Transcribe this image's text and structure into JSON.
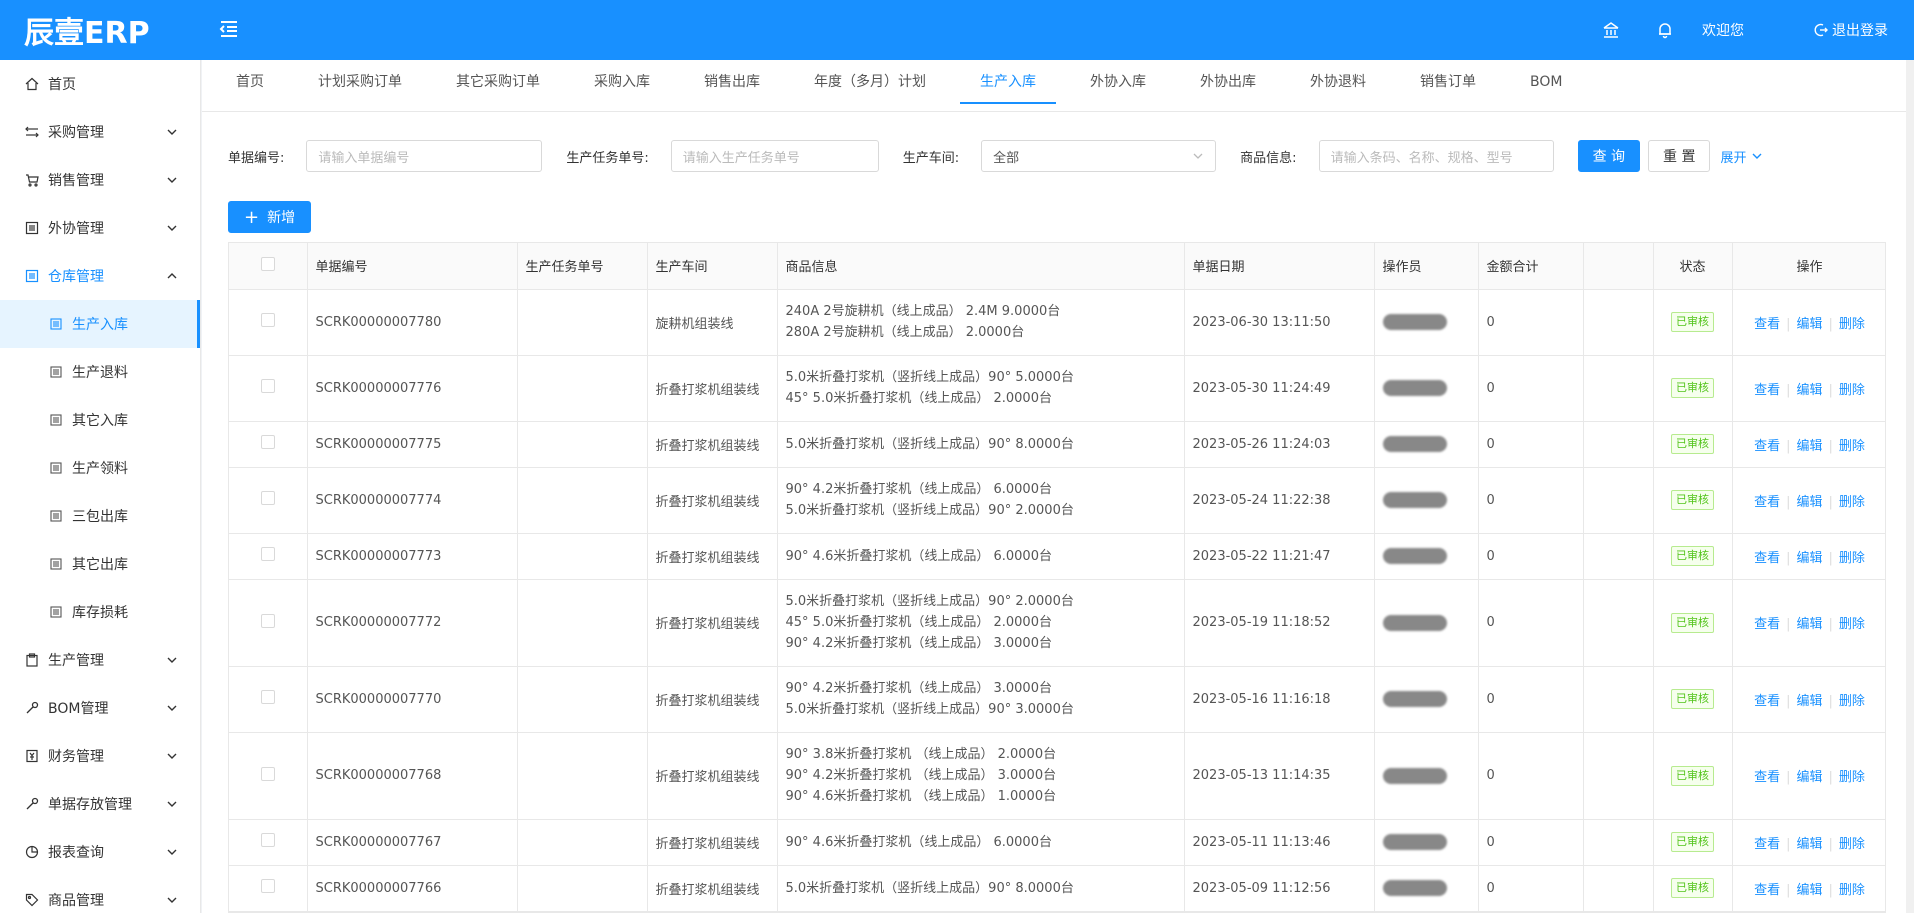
{
  "header": {
    "logo": "辰壹ERP",
    "welcome": "欢迎您",
    "logout": "退出登录"
  },
  "sidebar": {
    "items": [
      {
        "label": "首页",
        "icon": "home-icon"
      },
      {
        "label": "采购管理",
        "icon": "swap-icon"
      },
      {
        "label": "销售管理",
        "icon": "cart-icon"
      },
      {
        "label": "外协管理",
        "icon": "list-icon"
      },
      {
        "label": "仓库管理",
        "icon": "warehouse-icon"
      }
    ],
    "warehouse_sub": [
      {
        "label": "生产入库"
      },
      {
        "label": "生产退料"
      },
      {
        "label": "其它入库"
      },
      {
        "label": "生产领料"
      },
      {
        "label": "三包出库"
      },
      {
        "label": "其它出库"
      },
      {
        "label": "库存损耗"
      }
    ],
    "items_after": [
      {
        "label": "生产管理",
        "icon": "clipboard-icon"
      },
      {
        "label": "BOM管理",
        "icon": "wrench-icon"
      },
      {
        "label": "财务管理",
        "icon": "money-icon"
      },
      {
        "label": "单据存放管理",
        "icon": "tool-icon"
      },
      {
        "label": "报表查询",
        "icon": "pie-chart-icon"
      },
      {
        "label": "商品管理",
        "icon": "tag-icon"
      }
    ]
  },
  "tabs": [
    {
      "label": "首页"
    },
    {
      "label": "计划采购订单"
    },
    {
      "label": "其它采购订单"
    },
    {
      "label": "采购入库"
    },
    {
      "label": "销售出库"
    },
    {
      "label": "年度（多月）计划"
    },
    {
      "label": "生产入库"
    },
    {
      "label": "外协入库"
    },
    {
      "label": "外协出库"
    },
    {
      "label": "外协退料"
    },
    {
      "label": "销售订单"
    },
    {
      "label": "BOM"
    }
  ],
  "search": {
    "doc_no_label": "单据编号:",
    "doc_no_placeholder": "请输入单据编号",
    "task_no_label": "生产任务单号:",
    "task_no_placeholder": "请输入生产任务单号",
    "workshop_label": "生产车间:",
    "workshop_value": "全部",
    "goods_label": "商品信息:",
    "goods_placeholder": "请输入条码、名称、规格、型号",
    "query_btn": "查 询",
    "reset_btn": "重 置",
    "expand": "展开"
  },
  "add_btn": "新增",
  "table": {
    "headers": [
      "单据编号",
      "生产任务单号",
      "生产车间",
      "商品信息",
      "单据日期",
      "操作员",
      "金额合计",
      "",
      "状态",
      "操作"
    ],
    "ops": [
      "查看",
      "编辑",
      "删除"
    ],
    "rows": [
      {
        "doc": "SCRK00000007780",
        "task": "",
        "shop": "旋耕机组装线",
        "goods": [
          "240A 2号旋耕机（线上成品） 2.4M 9.0000台",
          "280A 2号旋耕机（线上成品） 2.0000台"
        ],
        "date": "2023-06-30 13:11:50",
        "amount": "0",
        "status": "已审核"
      },
      {
        "doc": "SCRK00000007776",
        "task": "",
        "shop": "折叠打浆机组装线",
        "goods": [
          "5.0米折叠打浆机（竖折线上成品）90° 5.0000台",
          "45° 5.0米折叠打浆机（线上成品） 2.0000台"
        ],
        "date": "2023-05-30 11:24:49",
        "amount": "0",
        "status": "已审核"
      },
      {
        "doc": "SCRK00000007775",
        "task": "",
        "shop": "折叠打浆机组装线",
        "goods": [
          "5.0米折叠打浆机（竖折线上成品）90° 8.0000台"
        ],
        "date": "2023-05-26 11:24:03",
        "amount": "0",
        "status": "已审核"
      },
      {
        "doc": "SCRK00000007774",
        "task": "",
        "shop": "折叠打浆机组装线",
        "goods": [
          "90° 4.2米折叠打浆机（线上成品） 6.0000台",
          "5.0米折叠打浆机（竖折线上成品）90° 2.0000台"
        ],
        "date": "2023-05-24 11:22:38",
        "amount": "0",
        "status": "已审核"
      },
      {
        "doc": "SCRK00000007773",
        "task": "",
        "shop": "折叠打浆机组装线",
        "goods": [
          "90° 4.6米折叠打浆机（线上成品） 6.0000台"
        ],
        "date": "2023-05-22 11:21:47",
        "amount": "0",
        "status": "已审核"
      },
      {
        "doc": "SCRK00000007772",
        "task": "",
        "shop": "折叠打浆机组装线",
        "goods": [
          "5.0米折叠打浆机（竖折线上成品）90° 2.0000台",
          "45° 5.0米折叠打浆机（线上成品） 2.0000台",
          "90° 4.2米折叠打浆机（线上成品） 3.0000台"
        ],
        "date": "2023-05-19 11:18:52",
        "amount": "0",
        "status": "已审核"
      },
      {
        "doc": "SCRK00000007770",
        "task": "",
        "shop": "折叠打浆机组装线",
        "goods": [
          "90° 4.2米折叠打浆机（线上成品） 3.0000台",
          "5.0米折叠打浆机（竖折线上成品）90° 3.0000台"
        ],
        "date": "2023-05-16 11:16:18",
        "amount": "0",
        "status": "已审核"
      },
      {
        "doc": "SCRK00000007768",
        "task": "",
        "shop": "折叠打浆机组装线",
        "goods": [
          "90° 3.8米折叠打浆机 （线上成品） 2.0000台",
          "90° 4.2米折叠打浆机 （线上成品） 3.0000台",
          "90° 4.6米折叠打浆机 （线上成品） 1.0000台"
        ],
        "date": "2023-05-13 11:14:35",
        "amount": "0",
        "status": "已审核"
      },
      {
        "doc": "SCRK00000007767",
        "task": "",
        "shop": "折叠打浆机组装线",
        "goods": [
          "90° 4.6米折叠打浆机（线上成品） 6.0000台"
        ],
        "date": "2023-05-11 11:13:46",
        "amount": "0",
        "status": "已审核"
      },
      {
        "doc": "SCRK00000007766",
        "task": "",
        "shop": "折叠打浆机组装线",
        "goods": [
          "5.0米折叠打浆机（竖折线上成品）90° 8.0000台"
        ],
        "date": "2023-05-09 11:12:56",
        "amount": "0",
        "status": "已审核"
      }
    ]
  }
}
